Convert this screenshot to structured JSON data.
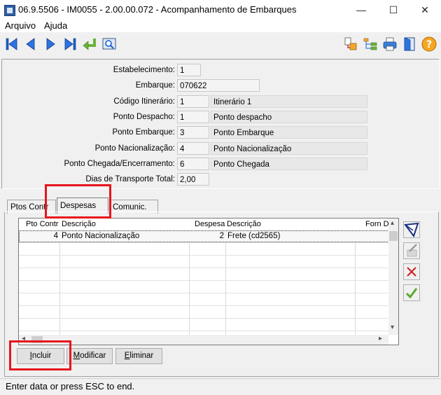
{
  "window": {
    "title": "06.9.5506 - IM0055 - 2.00.00.072 - Acompanhamento de Embarques",
    "minimize": "—",
    "maximize": "☐",
    "close": "✕"
  },
  "menu": {
    "items": [
      {
        "label": "Arquivo"
      },
      {
        "label": "Ajuda"
      }
    ]
  },
  "toolbar": {
    "nav_icons": [
      "first-record-icon",
      "previous-record-icon",
      "next-record-icon",
      "last-record-icon",
      "goto-icon",
      "search-icon"
    ],
    "right_icons": [
      "document-flow-icon",
      "tree-icon",
      "print-icon",
      "exit-icon",
      "help-icon"
    ]
  },
  "header": {
    "estabelecimento": {
      "label": "Estabelecimento:",
      "value": "1"
    },
    "embarque": {
      "label": "Embarque:",
      "value": "070622"
    },
    "codigo_itinerario": {
      "label": "Código Itinerário:",
      "value": "1",
      "desc": "Itinerário 1"
    },
    "ponto_despacho": {
      "label": "Ponto Despacho:",
      "value": "1",
      "desc": "Ponto despacho"
    },
    "ponto_embarque": {
      "label": "Ponto Embarque:",
      "value": "3",
      "desc": "Ponto Embarque"
    },
    "ponto_nacionalizacao": {
      "label": "Ponto Nacionalização:",
      "value": "4",
      "desc": "Ponto Nacionalização"
    },
    "ponto_chegada": {
      "label": "Ponto Chegada/Encerramento:",
      "value": "6",
      "desc": "Ponto Chegada"
    },
    "dias_transporte": {
      "label": "Dias de Transporte Total:",
      "value": "2,00"
    }
  },
  "tabs": [
    {
      "label": "Ptos Contr"
    },
    {
      "label": "Despesas"
    },
    {
      "label": "Comunic."
    }
  ],
  "grid": {
    "columns": [
      "Pto Contr",
      "Descrição",
      "Despesa",
      "Descrição",
      "Forn D"
    ],
    "rows": [
      {
        "pto": "4",
        "desc": "Ponto Nacionalização",
        "despesa": "2",
        "desp_desc": "Frete (cd2565)"
      }
    ],
    "scroll_left": "◂",
    "scroll_right": "▸",
    "scroll_up": "▴",
    "scroll_down": "▾"
  },
  "buttons": {
    "incluir": {
      "prefix": "",
      "accel": "I",
      "rest": "ncluir"
    },
    "modificar": {
      "prefix": "",
      "accel": "M",
      "rest": "odificar"
    },
    "eliminar": {
      "prefix": "",
      "accel": "E",
      "rest": "liminar"
    }
  },
  "status": {
    "text": "Enter data or press ESC to end."
  },
  "colors": {
    "highlight": "#e8141e",
    "nav_blue": "#1a5fd0",
    "accent_green": "#6bb43a"
  }
}
